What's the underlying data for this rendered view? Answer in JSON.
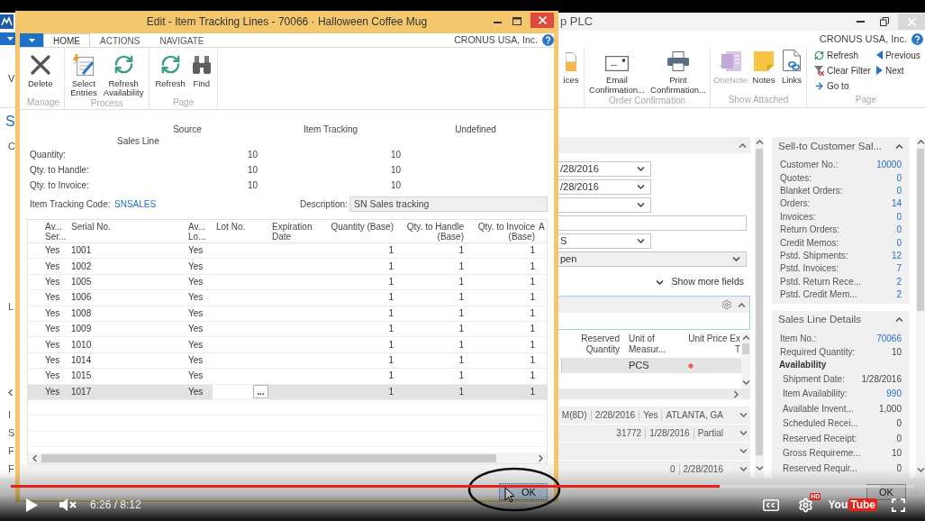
{
  "background_window": {
    "title": "p PLC",
    "company": "CRONUS USA, Inc.",
    "ribbon_fragment": "V",
    "ribbon_groups": [
      {
        "kind": "large",
        "actions": [
          {
            "lines": [
              "ices"
            ],
            "kind": "envelope",
            "disabled": false
          }
        ]
      },
      {
        "kind": "large",
        "label": "Order Confirmation",
        "actions": [
          {
            "lines": [
              "Email",
              "Confirmation..."
            ],
            "kind": "email",
            "disabled": false
          },
          {
            "lines": [
              "Print",
              "Confirmation..."
            ],
            "kind": "print",
            "disabled": false
          }
        ]
      },
      {
        "kind": "large",
        "label": "Show Attached",
        "actions": [
          {
            "lines": [
              "OneNote"
            ],
            "kind": "onenote",
            "disabled": true
          },
          {
            "lines": [
              "Notes"
            ],
            "kind": "notes",
            "disabled": false
          },
          {
            "lines": [
              "Links"
            ],
            "kind": "links",
            "disabled": false
          }
        ]
      },
      {
        "kind": "small",
        "label": "Page",
        "actions": [
          {
            "label": "Refresh",
            "kind": "refresh"
          },
          {
            "label": "Clear Filter",
            "kind": "clear_filter"
          },
          {
            "label": "Go to",
            "kind": "goto"
          },
          {
            "label": "Previous",
            "kind": "previous"
          },
          {
            "label": "Next",
            "kind": "next"
          }
        ]
      }
    ],
    "page_title_fragment": "S",
    "left_fragments": [
      "C",
      "L",
      "I",
      "S",
      "F",
      "F"
    ],
    "general": {
      "expanded": true,
      "fields": [
        {
          "kind": "dropdown",
          "value": "/28/2016"
        },
        {
          "kind": "dropdown",
          "value": "/28/2016"
        },
        {
          "kind": "dropdown"
        },
        {
          "kind": "text"
        },
        {
          "kind": "dropdown",
          "value": "S"
        },
        {
          "kind": "status",
          "value": "pen"
        }
      ],
      "show_more": "Show more fields"
    },
    "lines": {
      "expanded": true,
      "columns": [
        {
          "lines": [
            "Reserved",
            "Quantity"
          ]
        },
        {
          "lines": [
            "Unit of",
            "Measur..."
          ]
        },
        {
          "lines": [
            "Unit Price Ex",
            "T"
          ]
        }
      ],
      "row": {
        "unit": "PCS"
      }
    },
    "fasttabs": [
      {
        "values": [
          "M(8D)",
          "2/28/2016",
          "Yes",
          "ATLANTA, GA"
        ],
        "expanded": false
      },
      {
        "values": [
          "31772",
          "1/28/2016",
          "Partial"
        ],
        "expanded": false
      },
      {
        "expanded": false
      },
      {
        "values": [
          "0",
          "2/28/2016"
        ],
        "expanded": false
      }
    ],
    "factboxes": [
      {
        "title": "Sell-to Customer Sal...",
        "expanded": true,
        "rows": [
          {
            "label": "Customer No.:",
            "value": "10000",
            "kind": "link"
          },
          {
            "label": "Quotes:",
            "value": "0",
            "kind": "link"
          },
          {
            "label": "Blanket Orders:",
            "value": "0",
            "kind": "link"
          },
          {
            "label": "Orders:",
            "value": "14",
            "kind": "link"
          },
          {
            "label": "Invoices:",
            "value": "0",
            "kind": "link"
          },
          {
            "label": "Return Orders:",
            "value": "0",
            "kind": "link"
          },
          {
            "label": "Credit Memos:",
            "value": "0",
            "kind": "link"
          },
          {
            "label": "Pstd. Shipments:",
            "value": "12",
            "kind": "link"
          },
          {
            "label": "Pstd. Invoices:",
            "value": "7",
            "kind": "link"
          },
          {
            "label": "Pstd. Return Rece...",
            "value": "2",
            "kind": "link"
          },
          {
            "label": "Pstd. Credit Mem...",
            "value": "2",
            "kind": "link"
          }
        ]
      },
      {
        "title": "Sales Line Details",
        "expanded": true,
        "rows": [
          {
            "label": "Item No.:",
            "value": "70066",
            "kind": "link"
          },
          {
            "label": "Required Quantity:",
            "value": "10",
            "kind": "number"
          },
          {
            "label": "Availability",
            "kind": "heading",
            "children": [
              {
                "label": "Shipment Date:",
                "value": "1/28/2016",
                "kind": "number"
              },
              {
                "label": "Item Availability:",
                "value": "990",
                "kind": "link"
              },
              {
                "label": "Available Invent...",
                "value": "1,000",
                "kind": "number"
              },
              {
                "label": "Scheduled Recei...",
                "value": "0",
                "kind": "number"
              },
              {
                "label": "Reserved Receipt:",
                "value": "0",
                "kind": "number"
              },
              {
                "label": "Gross Requireme...",
                "value": "10",
                "kind": "number"
              },
              {
                "label": "Reserved Requir...",
                "value": "0",
                "kind": "number"
              }
            ]
          }
        ]
      }
    ],
    "ok_button": "OK"
  },
  "dialog": {
    "title": "Edit - Item Tracking Lines - 70066 · Halloween Coffee Mug",
    "tabs": [
      {
        "label": "HOME",
        "selected": true
      },
      {
        "label": "ACTIONS",
        "selected": false
      },
      {
        "label": "NAVIGATE",
        "selected": false
      }
    ],
    "company": "CRONUS USA, Inc.",
    "ribbon_groups": [
      {
        "label": "Manage",
        "actions": [
          {
            "lines": [
              "Delete"
            ],
            "kind": "delete"
          }
        ]
      },
      {
        "label": "Process",
        "actions": [
          {
            "lines": [
              "Select",
              "Entries"
            ],
            "kind": "select"
          },
          {
            "lines": [
              "Refresh",
              "Availability"
            ],
            "kind": "refresh"
          }
        ]
      },
      {
        "label": "Page",
        "actions": [
          {
            "lines": [
              "Refresh"
            ],
            "kind": "refresh"
          },
          {
            "lines": [
              "Find"
            ],
            "kind": "find"
          }
        ]
      }
    ],
    "summary": {
      "columns": [
        "Source",
        "Item Tracking",
        "Undefined"
      ],
      "source_name": "Sales Line",
      "rows": [
        {
          "label": "Quantity:",
          "source": "10",
          "item_tracking": "10"
        },
        {
          "label": "Qty. to Handle:",
          "source": "10",
          "item_tracking": "10"
        },
        {
          "label": "Qty. to Invoice:",
          "source": "10",
          "item_tracking": "10"
        }
      ]
    },
    "item_tracking_code": {
      "label": "Item Tracking Code:",
      "value": "SNSALES"
    },
    "description": {
      "label": "Description:",
      "value": "SN Sales tracking"
    },
    "table": {
      "columns": [
        {
          "lines": [
            "Av...",
            "Ser..."
          ]
        },
        {
          "lines": [
            "Serial No."
          ]
        },
        {
          "lines": [
            "Av...",
            "Lo..."
          ]
        },
        {
          "lines": [
            "Lot No."
          ]
        },
        {
          "lines": [
            "Expiration",
            "Date"
          ]
        },
        {
          "lines": [
            "Quantity (Base)"
          ]
        },
        {
          "lines": [
            "Qty. to Handle",
            "(Base)"
          ]
        },
        {
          "lines": [
            "Qty. to Invoice",
            "(Base)"
          ]
        },
        {
          "lines": [
            "A"
          ]
        }
      ],
      "rows": [
        {
          "available_serial": "Yes",
          "serial_no": "1001",
          "available_lot": "Yes",
          "quantity": "1",
          "qty_to_handle": "1",
          "qty_to_invoice": "1",
          "selected": false
        },
        {
          "available_serial": "Yes",
          "serial_no": "1002",
          "available_lot": "Yes",
          "quantity": "1",
          "qty_to_handle": "1",
          "qty_to_invoice": "1",
          "selected": false
        },
        {
          "available_serial": "Yes",
          "serial_no": "1005",
          "available_lot": "Yes",
          "quantity": "1",
          "qty_to_handle": "1",
          "qty_to_invoice": "1",
          "selected": false
        },
        {
          "available_serial": "Yes",
          "serial_no": "1006",
          "available_lot": "Yes",
          "quantity": "1",
          "qty_to_handle": "1",
          "qty_to_invoice": "1",
          "selected": false
        },
        {
          "available_serial": "Yes",
          "serial_no": "1008",
          "available_lot": "Yes",
          "quantity": "1",
          "qty_to_handle": "1",
          "qty_to_invoice": "1",
          "selected": false
        },
        {
          "available_serial": "Yes",
          "serial_no": "1009",
          "available_lot": "Yes",
          "quantity": "1",
          "qty_to_handle": "1",
          "qty_to_invoice": "1",
          "selected": false
        },
        {
          "available_serial": "Yes",
          "serial_no": "1010",
          "available_lot": "Yes",
          "quantity": "1",
          "qty_to_handle": "1",
          "qty_to_invoice": "1",
          "selected": false
        },
        {
          "available_serial": "Yes",
          "serial_no": "1014",
          "available_lot": "Yes",
          "quantity": "1",
          "qty_to_handle": "1",
          "qty_to_invoice": "1",
          "selected": false
        },
        {
          "available_serial": "Yes",
          "serial_no": "1015",
          "available_lot": "Yes",
          "quantity": "1",
          "qty_to_handle": "1",
          "qty_to_invoice": "1",
          "selected": false
        },
        {
          "available_serial": "Yes",
          "serial_no": "1017",
          "available_lot": "Yes",
          "quantity": "1",
          "qty_to_handle": "1",
          "qty_to_invoice": "1",
          "selected": true
        }
      ],
      "assist_button": "..."
    },
    "ok_button": "OK"
  },
  "player": {
    "progress": {
      "level": 0.785
    },
    "buffer": {
      "level": 0.962
    },
    "muted": true,
    "time": "6:26 / 8:12",
    "quality_badge": "HD",
    "logo": [
      "You",
      "Tube"
    ]
  }
}
